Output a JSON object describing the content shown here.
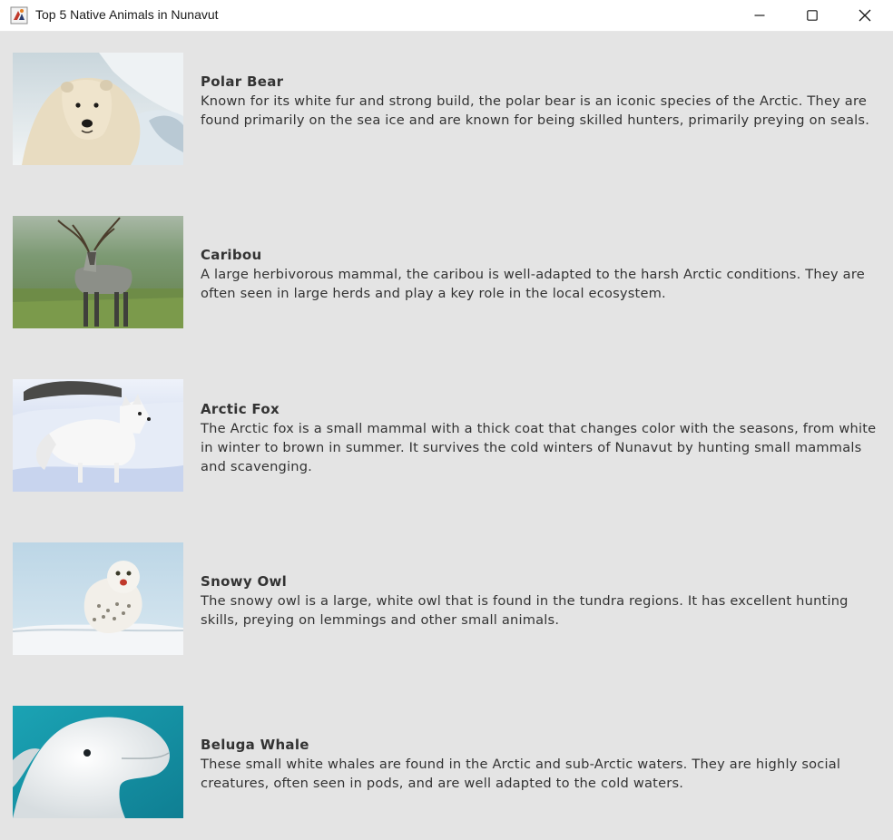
{
  "window": {
    "title": "Top 5 Native Animals in Nunavut",
    "icon": "java-app-icon",
    "controls": {
      "minimize": "minimize-icon",
      "maximize": "maximize-icon",
      "close": "close-icon"
    }
  },
  "animals": [
    {
      "name": "Polar Bear",
      "description": "Known for its white fur and strong build, the polar bear is an iconic species of the Arctic. They are found primarily on the sea ice and are known for being skilled hunters, primarily preying on seals.",
      "image": "polar-bear-photo"
    },
    {
      "name": "Caribou",
      "description": "A large herbivorous mammal, the caribou is well-adapted to the harsh Arctic conditions. They are often seen in large herds and play a key role in the local ecosystem.",
      "image": "caribou-photo"
    },
    {
      "name": "Arctic Fox",
      "description": "The Arctic fox is a small mammal with a thick coat that changes color with the seasons, from white in winter to brown in summer. It survives the cold winters of Nunavut by hunting small mammals and scavenging.",
      "image": "arctic-fox-photo"
    },
    {
      "name": "Snowy Owl",
      "description": "The snowy owl is a large, white owl that is found in the tundra regions. It has excellent hunting skills, preying on lemmings and other small animals.",
      "image": "snowy-owl-photo"
    },
    {
      "name": "Beluga Whale",
      "description": "These small white whales are found in the Arctic and sub-Arctic waters. They are highly social creatures, often seen in pods, and are well adapted to the cold waters.",
      "image": "beluga-whale-photo"
    }
  ]
}
